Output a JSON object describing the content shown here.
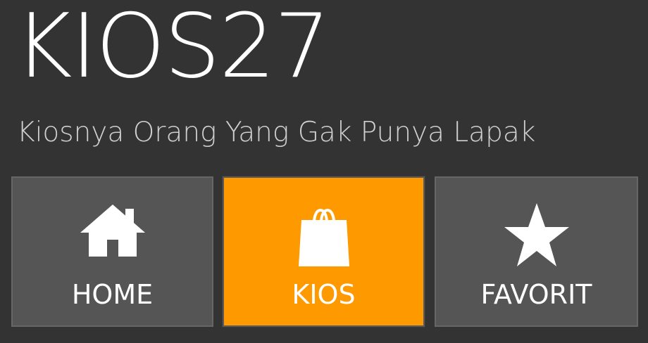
{
  "header": {
    "title": "KIOS27",
    "tagline": "Kiosnya Orang Yang Gak Punya Lapak"
  },
  "nav": {
    "items": [
      {
        "label": "HOME",
        "icon": "home-icon",
        "active": false
      },
      {
        "label": "KIOS",
        "icon": "shopping-bag-icon",
        "active": true
      },
      {
        "label": "FAVORIT",
        "icon": "star-icon",
        "active": false
      }
    ]
  },
  "colors": {
    "background": "#333333",
    "tile": "#555555",
    "active_tile": "#ff9900",
    "text": "#ffffff",
    "tagline": "#cfcfcf"
  }
}
